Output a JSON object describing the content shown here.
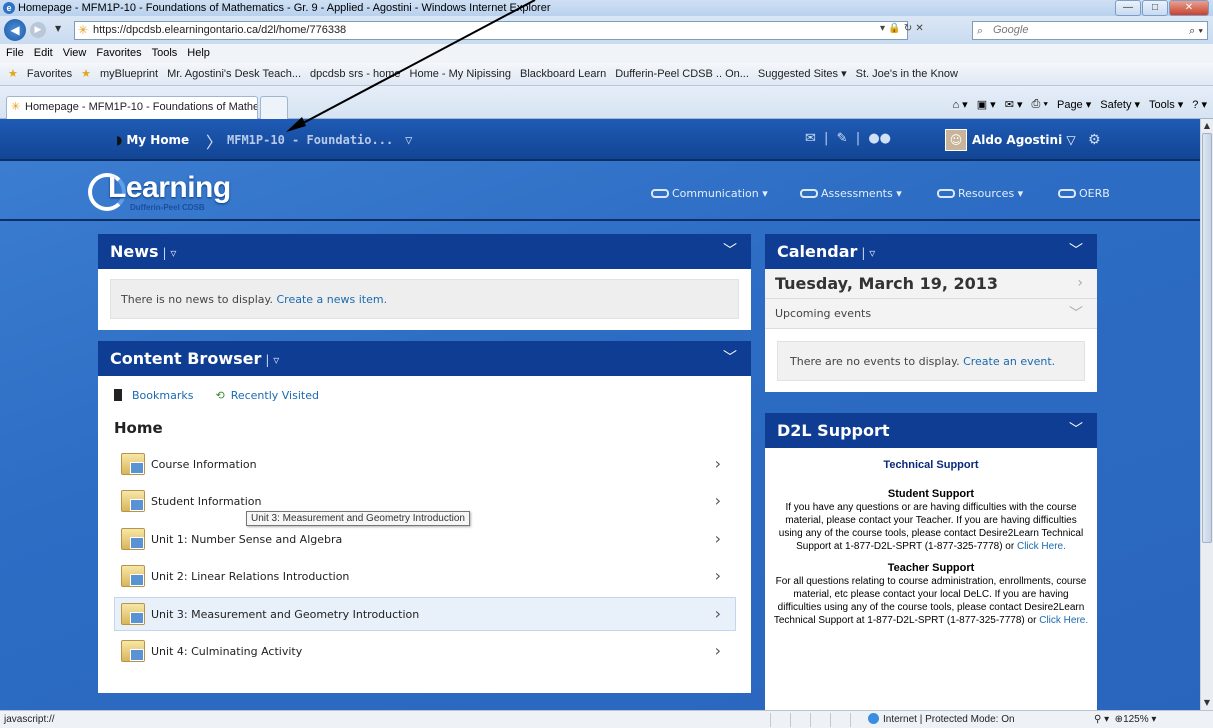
{
  "window": {
    "title": "Homepage - MFM1P-10 - Foundations of Mathematics - Gr. 9 - Applied - Agostini - Windows Internet Explorer",
    "url": "https://dpcdsb.elearningontario.ca/d2l/home/776338",
    "search_placeholder": "Google"
  },
  "menu": [
    "File",
    "Edit",
    "View",
    "Favorites",
    "Tools",
    "Help"
  ],
  "favorites": [
    "Favorites",
    "myBlueprint",
    "Mr. Agostini's Desk Teach...",
    "dpcdsb srs - home",
    "Home - My Nipissing",
    "Blackboard Learn",
    "Dufferin-Peel CDSB .. On...",
    "Suggested Sites ▾",
    "St. Joe's in the Know"
  ],
  "tab": {
    "label": "Homepage - MFM1P-10 - Foundations of Mathe..."
  },
  "command_bar": [
    "Page ▾",
    "Safety ▾",
    "Tools ▾"
  ],
  "minibar": {
    "home": "My Home",
    "course": "MFM1P-10 - Foundatio...",
    "user": "Aldo Agostini"
  },
  "logo": {
    "text": "Learning",
    "sub": "Dufferin-Peel CDSB"
  },
  "nav": [
    "Communication",
    "Assessments",
    "Resources",
    "OERB"
  ],
  "news": {
    "title": "News",
    "message": "There is no news to display.",
    "link": "Create a news item."
  },
  "content_browser": {
    "title": "Content Browser",
    "bookmarks": "Bookmarks",
    "recent": "Recently Visited",
    "home": "Home",
    "items": [
      "Course Information",
      "Student Information",
      "Unit 1: Number Sense and Algebra",
      "Unit 2: Linear Relations Introduction",
      "Unit 3: Measurement and Geometry Introduction",
      "Unit 4: Culminating Activity"
    ],
    "tooltip": "Unit 3: Measurement and Geometry Introduction"
  },
  "calendar": {
    "title": "Calendar",
    "date": "Tuesday, March 19, 2013",
    "upcoming": "Upcoming events",
    "message": "There are no events to display.",
    "link": "Create an event."
  },
  "support": {
    "title": "D2L Support",
    "heading": "Technical Support",
    "student_title": "Student Support",
    "student_text": "If you have any questions or are having difficulties with the course material, please contact your Teacher. If you are having difficulties using any of the course tools, please contact Desire2Learn Technical Support at 1-877-D2L-SPRT (1-877-325-7778) or",
    "teacher_title": "Teacher Support",
    "teacher_text": "For all questions relating to course administration, enrollments, course material, etc please contact your local DeLC.  If you are having difficulties using any of the course tools, please contact Desire2Learn Technical Support at 1-877-D2L-SPRT (1-877-325-7778) or",
    "click_here": "Click Here."
  },
  "status": {
    "left": "javascript://",
    "mode": "Internet | Protected Mode: On",
    "zoom": "125%"
  }
}
